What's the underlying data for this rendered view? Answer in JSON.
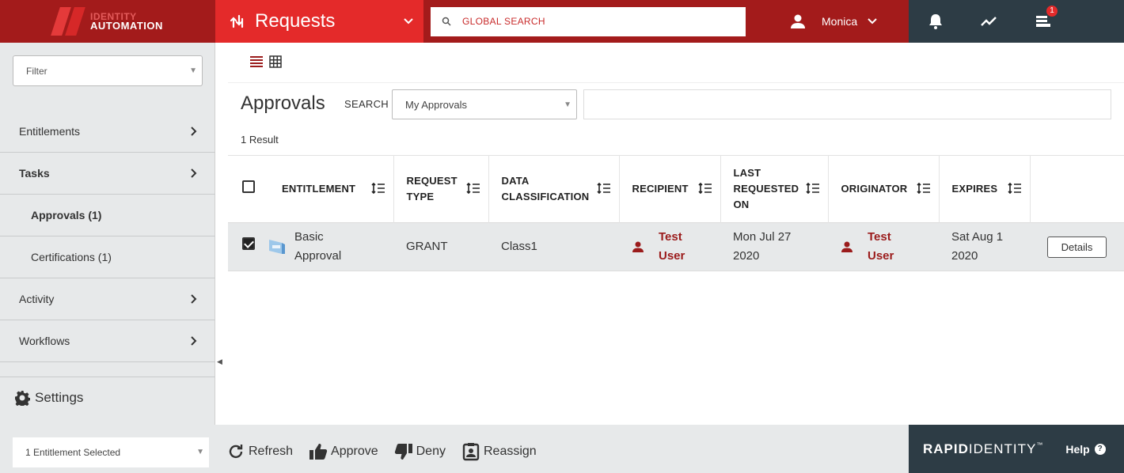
{
  "brand_logo": {
    "line1": "IDENTITY",
    "line2": "AUTOMATION"
  },
  "module": {
    "label": "Requests"
  },
  "global_search": {
    "placeholder": "GLOBAL SEARCH"
  },
  "user": {
    "name": "Monica"
  },
  "notifications": {
    "queue_badge": "1"
  },
  "sidebar": {
    "filter_placeholder": "Filter",
    "items": [
      {
        "label": "Entitlements"
      },
      {
        "label": "Tasks"
      },
      {
        "label": "Approvals (1)"
      },
      {
        "label": "Certifications (1)"
      },
      {
        "label": "Activity"
      },
      {
        "label": "Workflows"
      }
    ],
    "settings_label": "Settings"
  },
  "main": {
    "title": "Approvals",
    "search_label": "SEARCH",
    "search_select_value": "My Approvals",
    "result_count": "1 Result",
    "columns": [
      {
        "line1": "ENTITLEMENT",
        "line2": ""
      },
      {
        "line1": "REQUEST",
        "line2": "TYPE"
      },
      {
        "line1": "DATA",
        "line2": "CLASSIFICATION"
      },
      {
        "line1": "RECIPIENT",
        "line2": ""
      },
      {
        "line1": "LAST",
        "line2": "REQUESTED",
        "line3": "ON"
      },
      {
        "line1": "ORIGINATOR",
        "line2": ""
      },
      {
        "line1": "EXPIRES",
        "line2": ""
      }
    ],
    "rows": [
      {
        "entitlement_line1": "Basic",
        "entitlement_line2": "Approval",
        "request_type": "GRANT",
        "classification": "Class1",
        "recipient_line1": "Test",
        "recipient_line2": "User",
        "last_requested_line1": "Mon Jul 27",
        "last_requested_line2": "2020",
        "originator_line1": "Test",
        "originator_line2": "User",
        "expires_line1": "Sat Aug 1",
        "expires_line2": "2020",
        "details_label": "Details",
        "selected": true
      }
    ]
  },
  "footer": {
    "selection_count": "1 Entitlement Selected",
    "actions": [
      {
        "label": "Refresh"
      },
      {
        "label": "Approve"
      },
      {
        "label": "Deny"
      },
      {
        "label": "Reassign"
      }
    ],
    "brand_bold": "RAPID",
    "brand_light": "IDENTITY",
    "brand_tm": "™",
    "help_label": "Help"
  },
  "colors": {
    "primary_red": "#e42a2a",
    "dark_red": "#a31b1b",
    "slate": "#2d3c45",
    "link_red": "#9b1c1c"
  }
}
